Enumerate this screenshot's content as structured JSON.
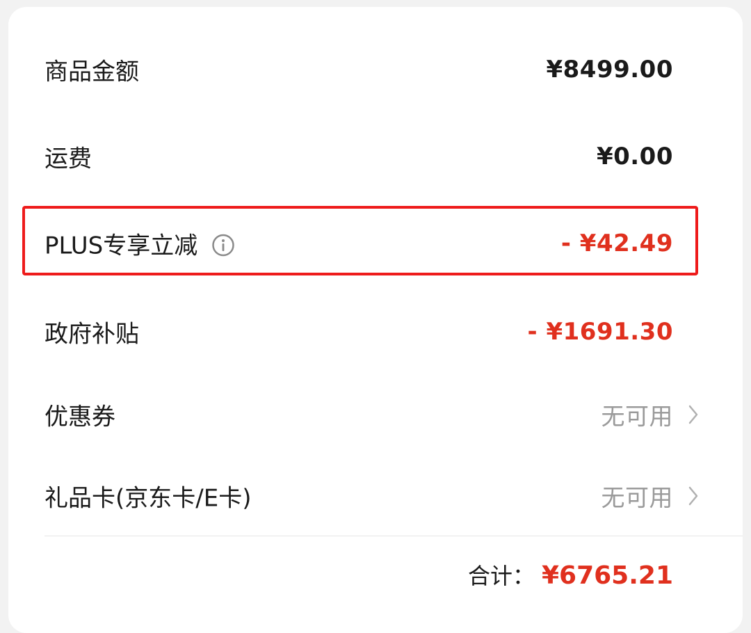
{
  "rows": [
    {
      "label": "商品金额",
      "value": "¥8499.00"
    },
    {
      "label": "运费",
      "value": "¥0.00"
    },
    {
      "label": "PLUS专享立减",
      "value": "- ¥42.49",
      "icon": "info-icon"
    },
    {
      "label": "政府补贴",
      "value": "- ¥1691.30"
    },
    {
      "label": "优惠券",
      "value": "无可用",
      "icon": "chevron-right-icon"
    },
    {
      "label": "礼品卡(京东卡/E卡)",
      "value": "无可用",
      "icon": "chevron-right-icon"
    }
  ],
  "total": {
    "label": "合计：",
    "value": "¥6765.21"
  },
  "colors": {
    "discount": "#e0301e",
    "highlight_border": "#ee1b1b",
    "muted": "#9a9a9a"
  }
}
